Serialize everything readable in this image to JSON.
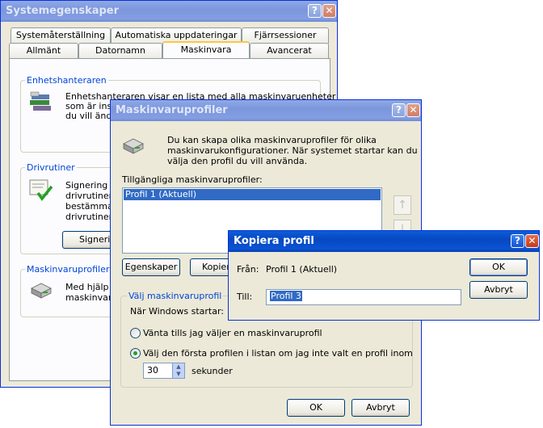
{
  "sysprops": {
    "title": "Systemegenskaper",
    "help": "?",
    "close": "✕",
    "tabs_row1": [
      "Systemåterställning",
      "Automatiska uppdateringar",
      "Fjärrsessioner"
    ],
    "tabs_row2": [
      "Allmänt",
      "Datornamn",
      "Maskinvara",
      "Avancerat"
    ],
    "devmgr": {
      "legend": "Enhetshanteraren",
      "lines": [
        "Enhetshanteraren visar en lista med alla maskinvaruenheter",
        "som är insta",
        "du vill ändra"
      ]
    },
    "drivers": {
      "legend": "Drivrutiner",
      "lines": [
        "Signering av",
        "drivrutiner s",
        "bestämma h",
        "drivrutiner."
      ],
      "button": "Signerin"
    },
    "hwprofiles": {
      "legend": "Maskinvaruprofiler",
      "lines": [
        "Med hjälp a",
        "maskinvaru"
      ]
    }
  },
  "profiles": {
    "title": "Maskinvaruprofiler",
    "help": "?",
    "close": "✕",
    "intro": [
      "Du kan skapa olika maskinvaruprofiler för olika",
      "maskinvarukonfigurationer. När systemet startar kan du",
      "välja den profil du vill använda."
    ],
    "list_label": "Tillgängliga maskinvaruprofiler:",
    "list_items": [
      "Profil 1 (Aktuell)"
    ],
    "up_arrow": "↑",
    "down_arrow": "↓",
    "btn_properties": "Egenskaper",
    "btn_copy": "Kopier",
    "group_legend": "Välj maskinvaruprofil",
    "startup_label": "När Windows startar:",
    "radio_wait": "Vänta tills jag väljer en maskinvaruprofil",
    "radio_first": "Välj den första profilen i listan om jag inte valt en profil inom",
    "seconds_value": "30",
    "seconds_label": "sekunder",
    "ok": "OK",
    "cancel": "Avbryt"
  },
  "copy": {
    "title": "Kopiera profil",
    "help": "?",
    "close": "✕",
    "from_label": "Från:",
    "from_value": "Profil 1 (Aktuell)",
    "to_label": "Till:",
    "to_value": "Profil 3",
    "ok": "OK",
    "cancel": "Avbryt"
  },
  "colors": {
    "titlebar_active": "#0a54d4",
    "titlebar_inactive": "#7c96dc",
    "dialog_bg": "#ece9d8",
    "selection": "#316ac5"
  }
}
